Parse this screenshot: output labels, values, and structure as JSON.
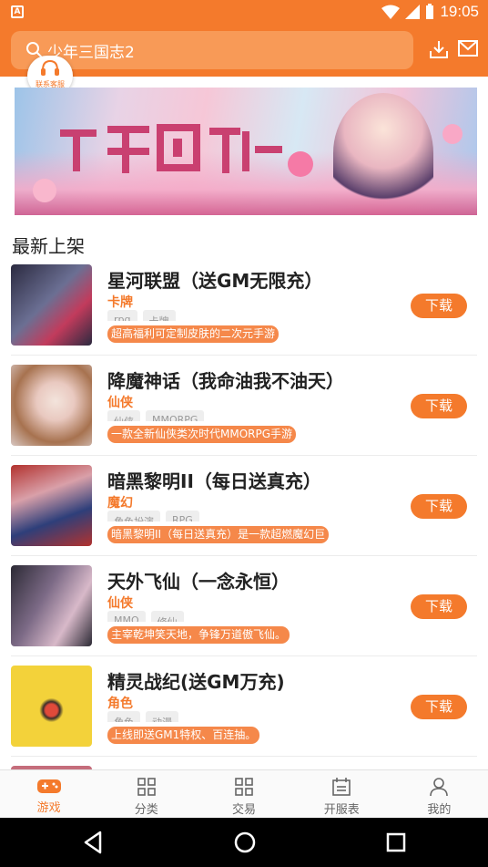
{
  "status_bar": {
    "time": "19:05"
  },
  "header": {
    "search_text": "少年三国志2",
    "customer_service_label": "联系客服"
  },
  "section": {
    "title": "最新上架"
  },
  "games": [
    {
      "name": "星河联盟（送GM无限充）",
      "category": "卡牌",
      "tags": [
        "rpg",
        "卡牌"
      ],
      "description": "超高福利可定制皮肤的二次元手游",
      "button": "下载",
      "thumb_colors": [
        "#2b2a40",
        "#c23b5c",
        "#6b6f93"
      ]
    },
    {
      "name": "降魔神话（我命油我不油天）",
      "category": "仙侠",
      "tags": [
        "仙侠",
        "MMORPG"
      ],
      "description": "一款全新仙侠类次时代MMORPG手游",
      "button": "下载",
      "thumb_colors": [
        "#e9c9c0",
        "#a7724f",
        "#f3e4dc"
      ]
    },
    {
      "name": "暗黑黎明II（每日送真充）",
      "category": "魔幻",
      "tags": [
        "角色扮演",
        "RPG"
      ],
      "description": "暗黑黎明II（每日送真充）是一款超燃魔幻巨",
      "button": "下载",
      "thumb_colors": [
        "#b2322e",
        "#2e3f7a",
        "#d9a0a9"
      ]
    },
    {
      "name": "天外飞仙（一念永恒）",
      "category": "仙侠",
      "tags": [
        "MMO",
        "修仙"
      ],
      "description": "主宰乾坤笑天地，争锋万道傲飞仙。",
      "button": "下载",
      "thumb_colors": [
        "#2c2a35",
        "#d8b9c9",
        "#7c6a86"
      ]
    },
    {
      "name": "精灵战纪(送GM万充)",
      "category": "角色",
      "tags": [
        "角色",
        "动漫"
      ],
      "description": "上线即送GM1特权、百连抽。",
      "button": "下载",
      "thumb_colors": [
        "#f3d23a",
        "#e04a3a",
        "#3d2f2a"
      ]
    }
  ],
  "bottom_nav": [
    {
      "label": "游戏",
      "icon": "gamepad-icon",
      "active": true
    },
    {
      "label": "分类",
      "icon": "grid-icon",
      "active": false
    },
    {
      "label": "交易",
      "icon": "grid-icon",
      "active": false
    },
    {
      "label": "开服表",
      "icon": "calendar-icon",
      "active": false
    },
    {
      "label": "我的",
      "icon": "person-icon",
      "active": false
    }
  ],
  "colors": {
    "brand": "#f47a2c",
    "accent_light": "#f89a57"
  }
}
